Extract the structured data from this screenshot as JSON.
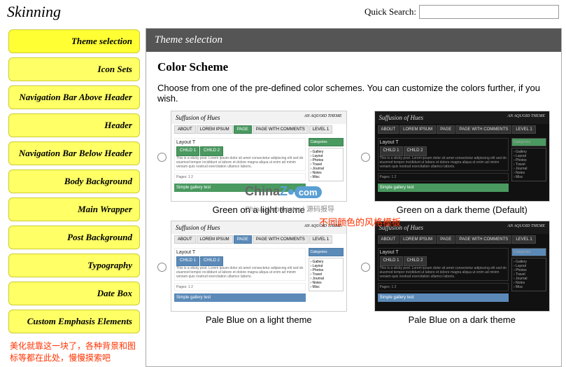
{
  "page_title": "Skinning",
  "search": {
    "label": "Quick Search:",
    "value": ""
  },
  "sidebar": {
    "items": [
      "Theme selection",
      "Icon Sets",
      "Navigation Bar Above Header",
      "Header",
      "Navigation Bar Below Header",
      "Body Background",
      "Main Wrapper",
      "Post Background",
      "Typography",
      "Date Box",
      "Custom Emphasis Elements"
    ],
    "note": "美化就靠这一块了，各种背景和图标等都在此处，慢慢摸索吧"
  },
  "main": {
    "header": "Theme selection",
    "section_title": "Color Scheme",
    "description": "Choose from one of the pre-defined color schemes. You can customize the colors further, if you wish.",
    "schemes": [
      {
        "caption": "Green on a light theme",
        "variant": "light",
        "accent": "green"
      },
      {
        "caption": "Green on a dark theme (Default)",
        "variant": "dark",
        "accent": "green"
      },
      {
        "caption": "Pale Blue on a light theme",
        "variant": "light",
        "accent": "blue"
      },
      {
        "caption": "Pale Blue on a dark theme",
        "variant": "dark",
        "accent": "blue"
      }
    ],
    "annotation": "不同颜色的风格模板"
  },
  "thumb": {
    "title": "Suffusion of Hues",
    "badge": "AN AQUOID THEME",
    "layout_label": "Layout T",
    "gallery_label": "Simple gallery test"
  },
  "watermark": {
    "brand_a": "China",
    "brand_b": "Z",
    "suffix": "com",
    "sub": "China Webmaster | 源码报导"
  }
}
